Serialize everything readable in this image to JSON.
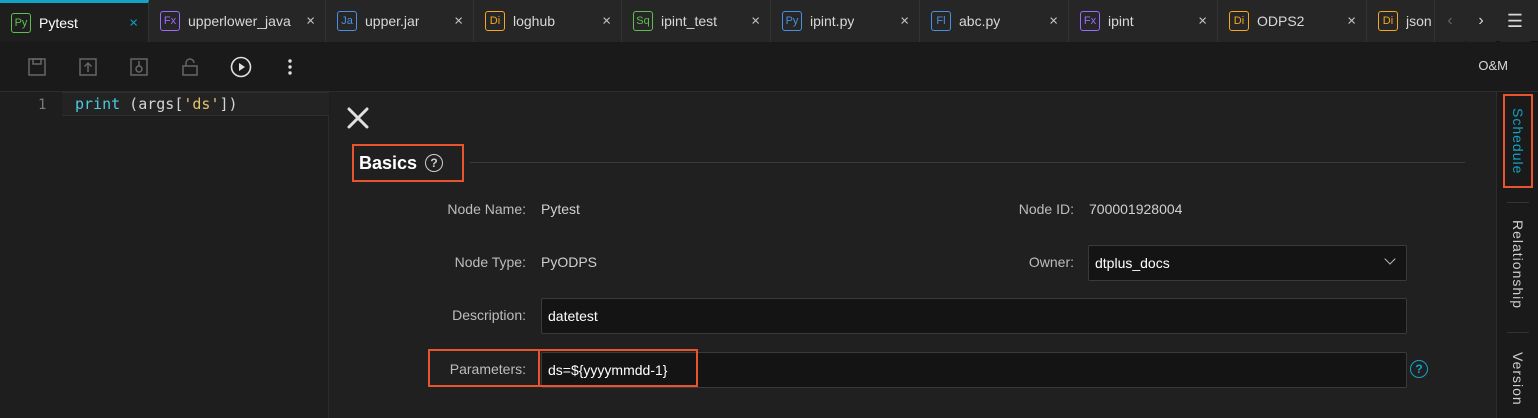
{
  "tabs": [
    {
      "badge": "Py",
      "label": "Pytest",
      "active": true
    },
    {
      "badge": "Fx",
      "label": "upperlower_java"
    },
    {
      "badge": "Ja",
      "label": "upper.jar"
    },
    {
      "badge": "Di",
      "label": "loghub"
    },
    {
      "badge": "Sq",
      "label": "ipint_test"
    },
    {
      "badge": "Py",
      "label": "ipint.py"
    },
    {
      "badge": "Fl",
      "label": "abc.py"
    },
    {
      "badge": "Fx",
      "label": "ipint"
    },
    {
      "badge": "Di",
      "label": "ODPS2"
    },
    {
      "badge": "Di",
      "label": "json"
    }
  ],
  "tab_close_glyph": "×",
  "tab_nav": {
    "prev": "‹",
    "next": "›",
    "menu": "☰"
  },
  "toolbar": {
    "icons": [
      "save-icon",
      "submit-icon",
      "steal-lock-icon",
      "lock-icon",
      "run-icon",
      "more-icon"
    ],
    "om_label": "O&M"
  },
  "editor": {
    "line_number": "1",
    "code_keyword": "print",
    "code_rest_a": " (args[",
    "code_string": "'ds'",
    "code_rest_b": "])"
  },
  "schedule": {
    "section_title": "Basics",
    "help_glyph": "?",
    "fields": {
      "node_name_label": "Node Name:",
      "node_name_value": "Pytest",
      "node_id_label": "Node ID:",
      "node_id_value": "700001928004",
      "node_type_label": "Node Type:",
      "node_type_value": "PyODPS",
      "owner_label": "Owner:",
      "owner_value": "dtplus_docs",
      "description_label": "Description:",
      "description_value": "datetest",
      "parameters_label": "Parameters:",
      "parameters_value": "ds=${yyyymmdd-1}"
    }
  },
  "rail": {
    "schedule": "Schedule",
    "relationship": "Relationship",
    "version": "Version"
  },
  "colors": {
    "accent": "#12a3c5",
    "highlight": "#e8542e"
  }
}
